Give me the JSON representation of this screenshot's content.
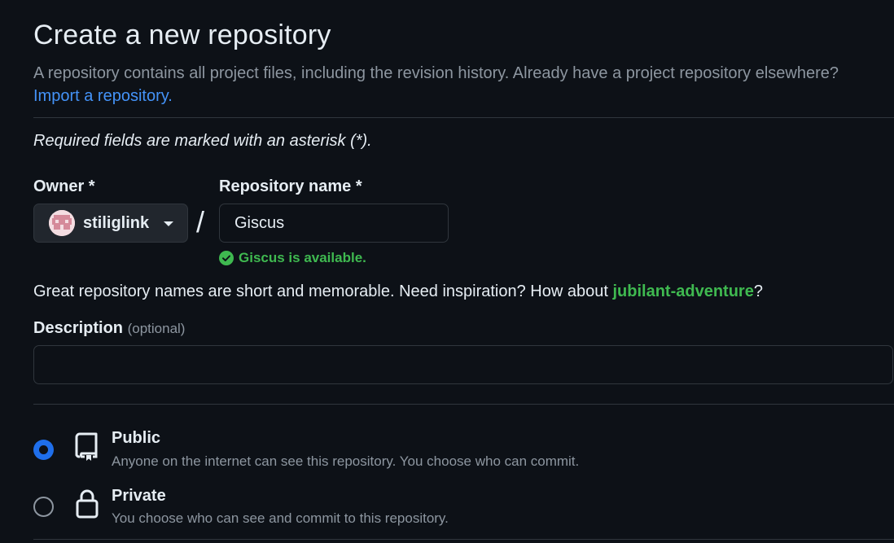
{
  "header": {
    "title": "Create a new repository",
    "subtitle": "A repository contains all project files, including the revision history. Already have a project repository elsewhere?",
    "import_link": "Import a repository."
  },
  "form": {
    "required_note": "Required fields are marked with an asterisk (*).",
    "owner": {
      "label": "Owner *",
      "value": "stiliglink"
    },
    "separator": "/",
    "repo_name": {
      "label": "Repository name *",
      "value": "Giscus",
      "availability": "Giscus is available."
    },
    "suggestion": {
      "prefix": "Great repository names are short and memorable. Need inspiration? How about ",
      "name": "jubilant-adventure",
      "suffix": "?"
    },
    "description": {
      "label": "Description",
      "optional": "(optional)",
      "value": ""
    },
    "visibility": [
      {
        "title": "Public",
        "description": "Anyone on the internet can see this repository. You choose who can commit.",
        "icon": "repo-icon",
        "selected": true
      },
      {
        "title": "Private",
        "description": "You choose who can see and commit to this repository.",
        "icon": "lock-icon",
        "selected": false
      }
    ]
  },
  "colors": {
    "background": "#0d1117",
    "accent_link": "#4493f8",
    "success": "#3fb950",
    "radio_selected": "#1f6feb"
  }
}
